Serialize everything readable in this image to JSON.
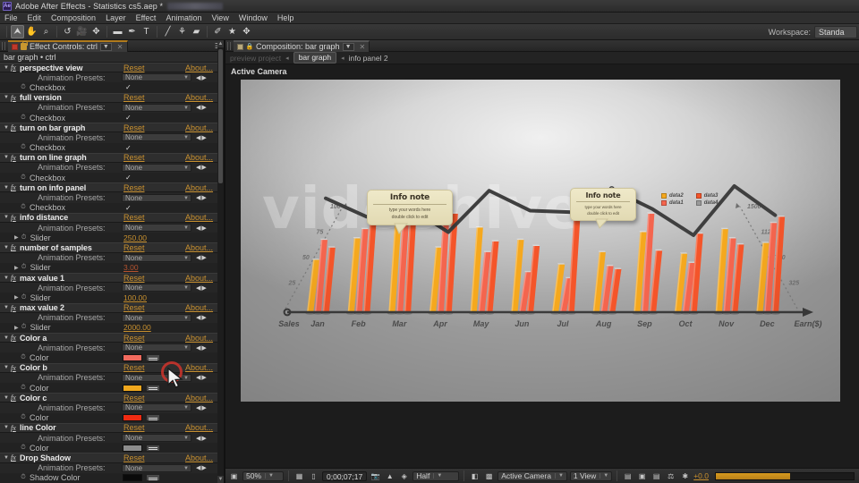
{
  "window": {
    "app_icon": "Ae",
    "title": "Adobe After Effects - Statistics cs5.aep *"
  },
  "menubar": {
    "items": [
      "File",
      "Edit",
      "Composition",
      "Layer",
      "Effect",
      "Animation",
      "View",
      "Window",
      "Help"
    ]
  },
  "toolbar": {
    "tools": [
      {
        "name": "selection-tool",
        "glyph": "⮝"
      },
      {
        "name": "hand-tool",
        "glyph": "✋"
      },
      {
        "name": "zoom-tool",
        "glyph": "⌕"
      },
      {
        "name": "rotation-tool",
        "glyph": "↺"
      },
      {
        "name": "camera-tool",
        "glyph": "🎥"
      },
      {
        "name": "pan-behind-tool",
        "glyph": "✥"
      },
      {
        "name": "shape-tool",
        "glyph": "▬"
      },
      {
        "name": "pen-tool",
        "glyph": "✒"
      },
      {
        "name": "text-tool",
        "glyph": "T"
      },
      {
        "name": "brush-tool",
        "glyph": "╱"
      },
      {
        "name": "clone-stamp-tool",
        "glyph": "⚘"
      },
      {
        "name": "eraser-tool",
        "glyph": "▰"
      },
      {
        "name": "roto-brush-tool",
        "glyph": "✐"
      },
      {
        "name": "puppet-pin-tool",
        "glyph": "★"
      },
      {
        "name": "align-tool",
        "glyph": "✥"
      }
    ],
    "workspace_label": "Workspace:",
    "workspace_value": "Standa"
  },
  "effect_controls": {
    "tab_title": "Effect Controls: ctrl",
    "header": "bar graph • ctrl",
    "reset_label": "Reset",
    "about_label": "About...",
    "presets_label": "Animation Presets:",
    "presets_value": "None",
    "effects": [
      {
        "name": "perspective view",
        "prop_type": "checkbox",
        "prop_label": "Checkbox",
        "checked": true
      },
      {
        "name": "full version",
        "prop_type": "checkbox",
        "prop_label": "Checkbox",
        "checked": true
      },
      {
        "name": "turn on  bar graph",
        "prop_type": "checkbox",
        "prop_label": "Checkbox",
        "checked": true
      },
      {
        "name": "turn on  line graph",
        "prop_type": "checkbox",
        "prop_label": "Checkbox",
        "checked": true
      },
      {
        "name": "turn on  info panel",
        "prop_type": "checkbox",
        "prop_label": "Checkbox",
        "checked": true
      },
      {
        "name": "info distance",
        "prop_type": "slider",
        "prop_label": "Slider",
        "value": "250.00"
      },
      {
        "name": "number of samples",
        "prop_type": "slider",
        "prop_label": "Slider",
        "value": "3.00",
        "value_color": "red"
      },
      {
        "name": "max value 1",
        "prop_type": "slider",
        "prop_label": "Slider",
        "value": "100.00"
      },
      {
        "name": "max value 2",
        "prop_type": "slider",
        "prop_label": "Slider",
        "value": "2000.00"
      },
      {
        "name": "Color a",
        "prop_type": "color",
        "prop_label": "Color",
        "color": "#f26b5e"
      },
      {
        "name": "Color b",
        "prop_type": "color",
        "prop_label": "Color",
        "color": "#f0a81e"
      },
      {
        "name": "Color c",
        "prop_type": "color",
        "prop_label": "Color",
        "color": "#f02b12"
      },
      {
        "name": "line Color",
        "prop_type": "color",
        "prop_label": "Color",
        "color": "#8c8c8c"
      },
      {
        "name": "Drop Shadow",
        "prop_type": "color",
        "prop_label": "Shadow Color",
        "color": "#0a0a0a"
      }
    ]
  },
  "composition": {
    "tab_title": "Composition: bar graph",
    "subtabs": [
      {
        "label": "preview project",
        "state": "ghost"
      },
      {
        "label": "bar graph",
        "state": "active"
      },
      {
        "label": "info panel  2",
        "state": "plain"
      }
    ],
    "view_label": "Active Camera",
    "bottom_bar": {
      "zoom": "50%",
      "timecode": "0;00;07;17",
      "resolution": "Half",
      "camera": "Active Camera",
      "views": "1 View",
      "exposure": "+0.0"
    }
  },
  "chart_data": {
    "type": "bar",
    "title": "",
    "xlabel": "",
    "ylabel": "",
    "axis_start_label": "Sales",
    "axis_end_label": "Earn($)",
    "categories": [
      "Jan",
      "Feb",
      "Mar",
      "Apr",
      "May",
      "Jun",
      "Jul",
      "Aug",
      "Sep",
      "Oct",
      "Nov",
      "Dec"
    ],
    "left_axis_ticks": [
      "25",
      "50",
      "75",
      "100"
    ],
    "right_axis_ticks": [
      "325",
      "750",
      "1125",
      "1500"
    ],
    "left_axis_range": [
      0,
      100
    ],
    "right_axis_range": [
      0,
      1500
    ],
    "grid": false,
    "legend_position": "top-right",
    "legend": [
      {
        "label": "data2",
        "color": "#f5a81e"
      },
      {
        "label": "data3",
        "color": "#f4552a"
      },
      {
        "label": "data1",
        "color": "#f4654e"
      },
      {
        "label": "data4",
        "color": "#9a9a9a"
      }
    ],
    "series": [
      {
        "name": "data2",
        "color": "#f5a81e",
        "values": [
          34,
          48,
          59,
          42,
          55,
          47,
          31,
          39,
          52,
          38,
          54,
          45
        ]
      },
      {
        "name": "data1",
        "color": "#f4654e",
        "values": [
          47,
          54,
          62,
          69,
          39,
          26,
          22,
          30,
          64,
          32,
          48,
          58
        ]
      },
      {
        "name": "data3",
        "color": "#f4552a",
        "values": [
          42,
          58,
          71,
          64,
          46,
          43,
          65,
          28,
          40,
          51,
          44,
          62
        ]
      }
    ],
    "line_series": {
      "name": "line graph",
      "color": "#3f3f3f",
      "values": [
        74,
        62,
        69,
        52,
        79,
        66,
        65,
        80,
        67,
        50,
        82,
        63
      ]
    },
    "notes": [
      {
        "title": "Info note",
        "line1": "type your words here",
        "line2": "double click to edit",
        "anchor_category": "Mar"
      },
      {
        "title": "Info note",
        "line1": "type your words here",
        "line2": "double click to edit",
        "anchor_category": "Aug"
      }
    ],
    "watermark": "videohive"
  }
}
